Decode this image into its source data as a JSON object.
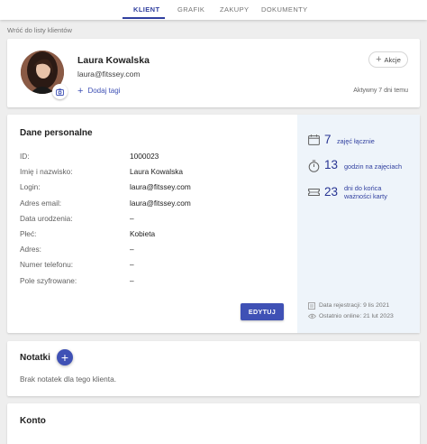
{
  "tabs": [
    {
      "label": "KLIENT",
      "active": true
    },
    {
      "label": "GRAFIK",
      "active": false
    },
    {
      "label": "ZAKUPY",
      "active": false
    },
    {
      "label": "DOKUMENTY",
      "active": false
    }
  ],
  "back_link": "Wróć do listy klientów",
  "client": {
    "name": "Laura Kowalska",
    "email": "laura@fitssey.com",
    "add_tags": "Dodaj tagi",
    "actions_button": "Akcje",
    "active_since": "Aktywny 7 dni temu"
  },
  "personal": {
    "title": "Dane personalne",
    "fields": [
      {
        "label": "ID:",
        "value": "1000023"
      },
      {
        "label": "Imię i nazwisko:",
        "value": "Laura Kowalska"
      },
      {
        "label": "Login:",
        "value": "laura@fitssey.com"
      },
      {
        "label": "Adres email:",
        "value": "laura@fitssey.com"
      },
      {
        "label": "Data urodzenia:",
        "value": "–"
      },
      {
        "label": "Płeć:",
        "value": "Kobieta"
      },
      {
        "label": "Adres:",
        "value": "–"
      },
      {
        "label": "Numer telefonu:",
        "value": "–"
      },
      {
        "label": "Pole szyfrowane:",
        "value": "–"
      }
    ],
    "edit_button": "EDYTUJ"
  },
  "stats": {
    "classes_total": {
      "number": "7",
      "text": "zajęć łącznie",
      "icon": "calendar-icon"
    },
    "hours": {
      "number": "13",
      "text": "godzin na zajęciach",
      "icon": "stopwatch-icon"
    },
    "days_left": {
      "number": "23",
      "text_line1": "dni do końca",
      "text_line2": "ważności karty",
      "icon": "ticket-icon"
    },
    "registered": "Data rejestracji: 9 lis 2021",
    "last_online": "Ostatnio online: 21 lut 2023"
  },
  "notes": {
    "title": "Notatki",
    "empty_text": "Brak notatek dla tego klienta."
  },
  "account": {
    "title": "Konto"
  },
  "colors": {
    "accent": "#3f51b5",
    "stats_bg": "#eef4fa",
    "page_bg": "#eeeeee"
  }
}
